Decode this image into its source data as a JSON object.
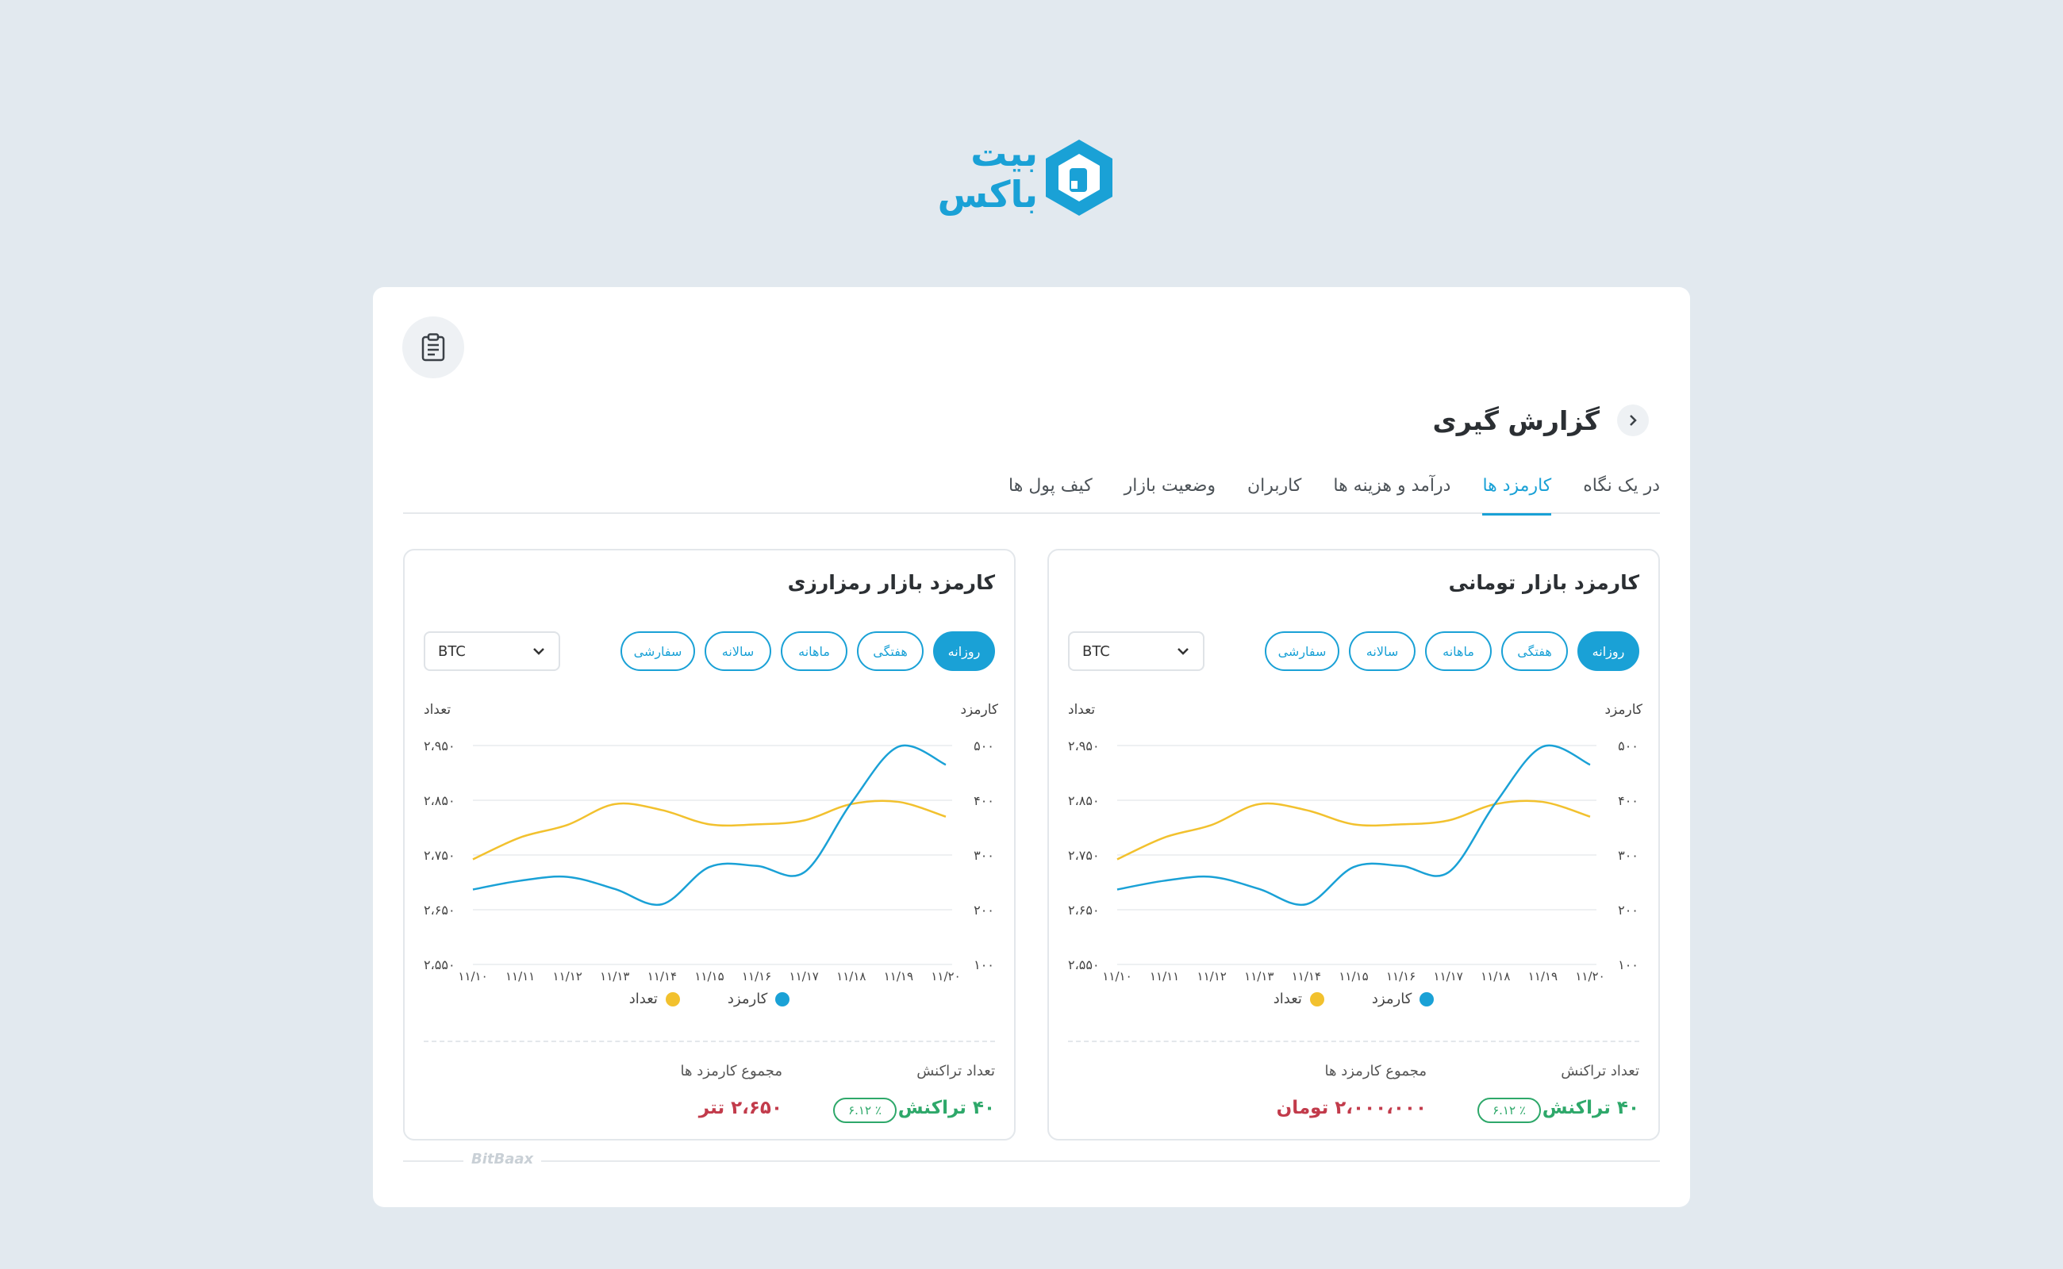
{
  "brand": {
    "name_line1": "بیت",
    "name_line2": "باکس",
    "color": "#1aa1d6",
    "watermark": "BitBaax"
  },
  "header": {
    "title": "گزارش گیری",
    "back_icon": "chevron-right-icon",
    "report_icon": "clipboard-icon"
  },
  "tabs": [
    {
      "label": "در یک نگاه",
      "active": false
    },
    {
      "label": "کارمزد ها",
      "active": true
    },
    {
      "label": "درآمد و هزینه ها",
      "active": false
    },
    {
      "label": "کاربران",
      "active": false
    },
    {
      "label": "وضعیت بازار",
      "active": false
    },
    {
      "label": "کیف پول ها",
      "active": false
    }
  ],
  "panels": [
    {
      "title": "کارمزد بازار تومانی",
      "periods": [
        "روزانه",
        "هفتگی",
        "ماهانه",
        "سالانه",
        "سفارشی"
      ],
      "active_period": "روزانه",
      "select_value": "BTC",
      "stats": {
        "tx_label": "تعداد تراکنش",
        "tx_value": "۴۰ تراکنش",
        "tx_change": "٪ ۶.۱۲",
        "sum_label": "مجموع کارمزد ها",
        "sum_value": "۲،۰۰۰،۰۰۰ تومان"
      }
    },
    {
      "title": "کارمزد بازار رمزارزی",
      "periods": [
        "روزانه",
        "هفتگی",
        "ماهانه",
        "سالانه",
        "سفارشی"
      ],
      "active_period": "روزانه",
      "select_value": "BTC",
      "stats": {
        "tx_label": "تعداد تراکنش",
        "tx_value": "۴۰ تراکنش",
        "tx_change": "٪ ۶.۱۲",
        "sum_label": "مجموع کارمزد ها",
        "sum_value": "۲،۶۵۰ تتر"
      }
    }
  ],
  "chart_data": {
    "type": "line",
    "categories": [
      "۱۱/۱۰",
      "۱۱/۱۱",
      "۱۱/۱۲",
      "۱۱/۱۳",
      "۱۱/۱۴",
      "۱۱/۱۵",
      "۱۱/۱۶",
      "۱۱/۱۷",
      "۱۱/۱۸",
      "۱۱/۱۹",
      "۱۱/۲۰"
    ],
    "left_axis_label": "تعداد",
    "right_axis_label": "کارمزد",
    "left_ticks": [
      "۲،۹۵۰",
      "۲،۸۵۰",
      "۲،۷۵۰",
      "۲،۶۵۰",
      "۲،۵۵۰"
    ],
    "right_ticks": [
      "۵۰۰",
      "۴۰۰",
      "۳۰۰",
      "۲۰۰",
      "۱۰۰"
    ],
    "left_range": [
      2550,
      2950
    ],
    "right_range": [
      100,
      500
    ],
    "series": [
      {
        "name": "کارمزد",
        "axis": "right",
        "color": "#1aa1d6",
        "values": [
          237,
          253,
          260,
          238,
          210,
          278,
          280,
          268,
          395,
          498,
          465
        ]
      },
      {
        "name": "تعداد",
        "axis": "left",
        "color": "#f2c12e",
        "values": [
          2742,
          2782,
          2805,
          2843,
          2832,
          2806,
          2806,
          2813,
          2843,
          2847,
          2820
        ]
      }
    ],
    "grid": true,
    "legend_position": "bottom-center"
  }
}
